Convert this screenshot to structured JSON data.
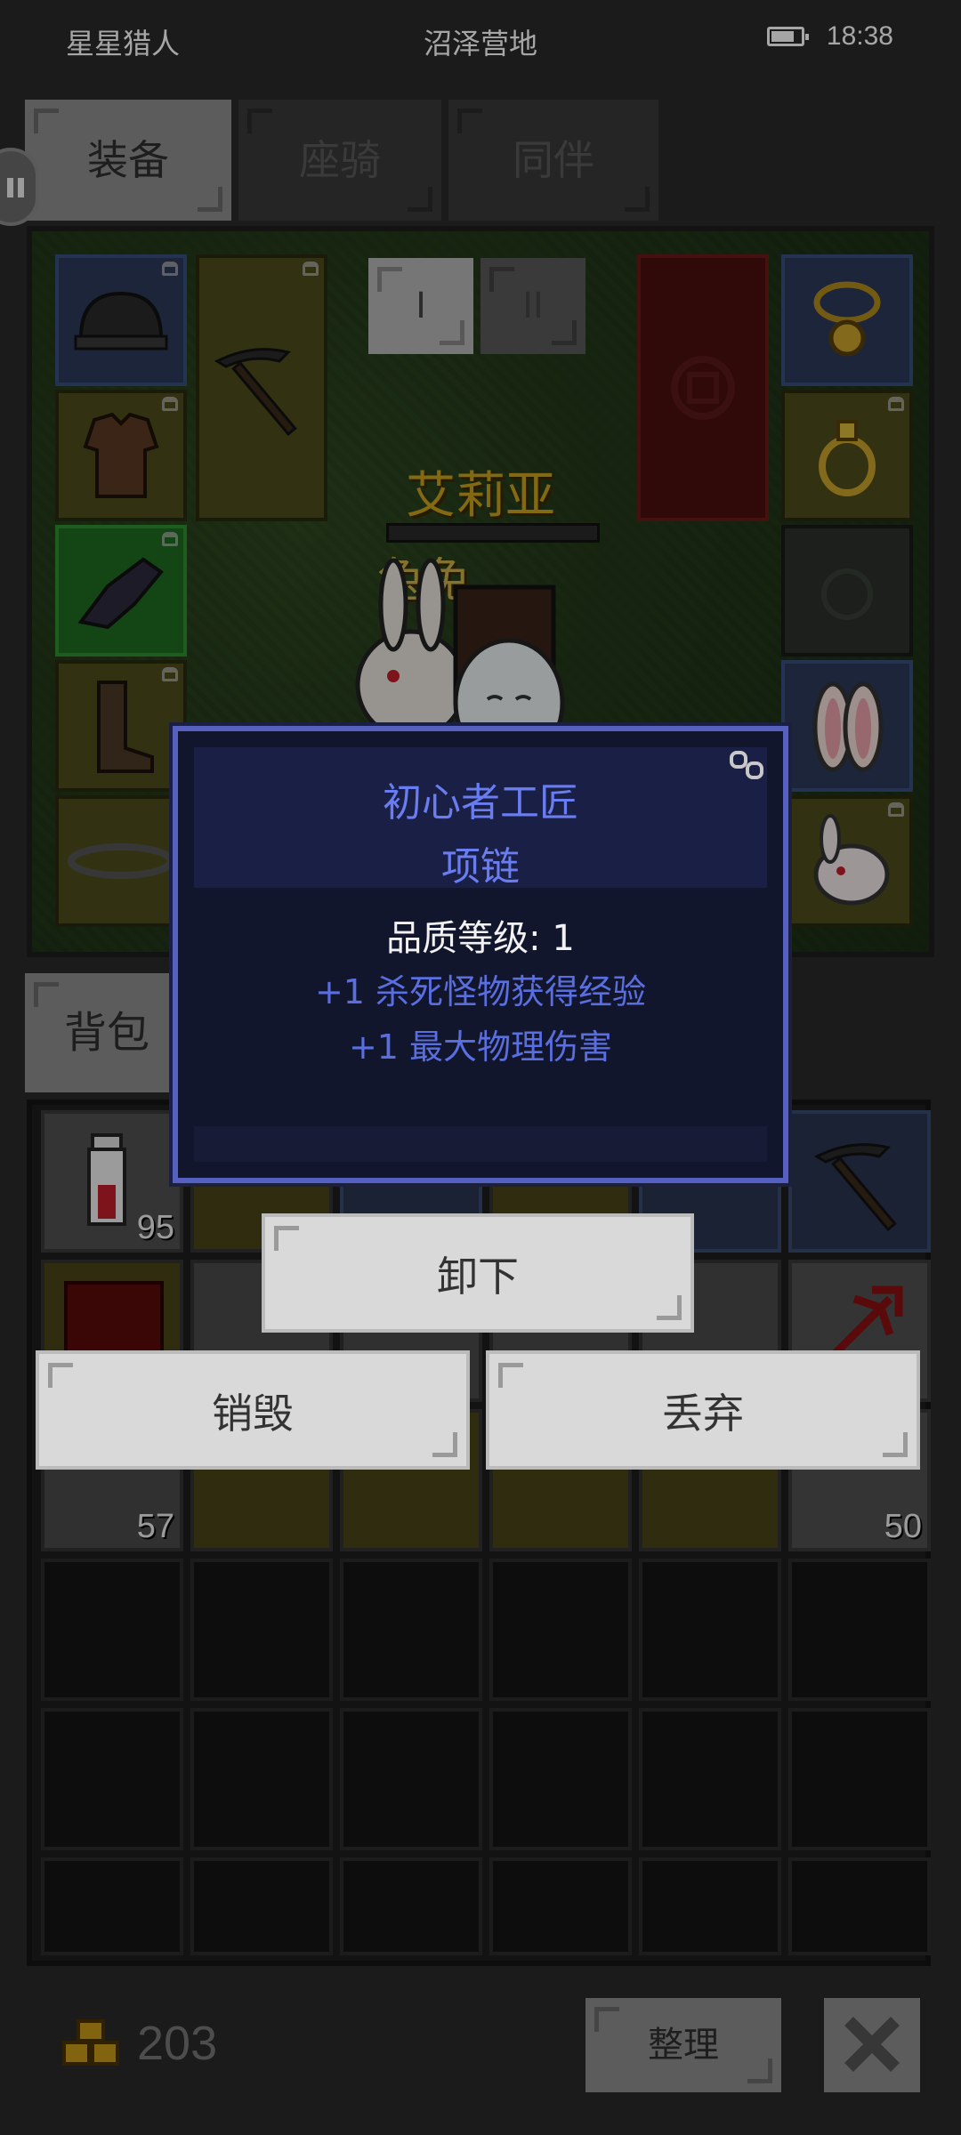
{
  "status_bar": {
    "left_label": "星星猎人",
    "location": "沼泽营地",
    "time": "18:38",
    "battery_level": 0.7
  },
  "tabs": [
    {
      "label": "装备",
      "active": true
    },
    {
      "label": "座骑",
      "active": false
    },
    {
      "label": "同伴",
      "active": false
    }
  ],
  "equipment": {
    "pager": [
      "I",
      "II"
    ],
    "character_name": "艾莉亚",
    "pet_name": "兔兔",
    "slots_left": [
      "helmet-icon",
      "pickaxe-icon",
      "armor-icon",
      "gloves-icon",
      "boots-icon",
      "belt-icon"
    ],
    "slots_right": [
      "necklace-icon",
      "ring-icon",
      "empty-ring-slot",
      "bunny-ears-icon",
      "bunny-pet-icon"
    ]
  },
  "backpack": {
    "tab_label": "背包",
    "stack_counts": {
      "potion": "95",
      "row3_first": "57",
      "row3_last": "50"
    }
  },
  "tooltip": {
    "title": "初心者工匠",
    "item_type": "项链",
    "quality": "品质等级: 1",
    "stat1": "+1 杀死怪物获得经验",
    "stat2": "+1 最大物理伤害"
  },
  "actions": {
    "unequip": "卸下",
    "destroy": "销毁",
    "drop": "丢弃"
  },
  "footer": {
    "gold": "203",
    "sort_label": "整理"
  },
  "colors": {
    "tooltip_text": "#6a7df0",
    "tooltip_border": "#5560c0",
    "gold_text": "#c9a21b"
  }
}
